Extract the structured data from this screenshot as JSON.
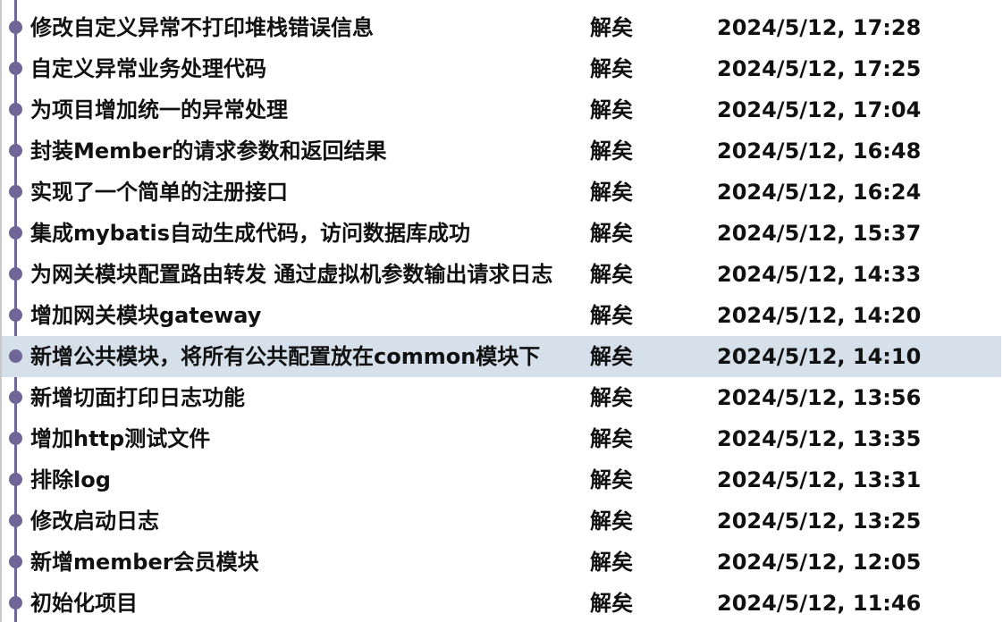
{
  "commits": [
    {
      "message": "修改自定义异常不打印堆栈错误信息",
      "author": "解矣",
      "date": "2024/5/12, 17:28"
    },
    {
      "message": "自定义异常业务处理代码",
      "author": "解矣",
      "date": "2024/5/12, 17:25"
    },
    {
      "message": "为项目增加统一的异常处理",
      "author": "解矣",
      "date": "2024/5/12, 17:04"
    },
    {
      "message": "封装Member的请求参数和返回结果",
      "author": "解矣",
      "date": "2024/5/12, 16:48"
    },
    {
      "message": "实现了一个简单的注册接口",
      "author": "解矣",
      "date": "2024/5/12, 16:24"
    },
    {
      "message": "集成mybatis自动生成代码，访问数据库成功",
      "author": "解矣",
      "date": "2024/5/12, 15:37"
    },
    {
      "message": "为网关模块配置路由转发 通过虚拟机参数输出请求日志",
      "author": "解矣",
      "date": "2024/5/12, 14:33"
    },
    {
      "message": "增加网关模块gateway",
      "author": "解矣",
      "date": "2024/5/12, 14:20"
    },
    {
      "message": "新增公共模块，将所有公共配置放在common模块下",
      "author": "解矣",
      "date": "2024/5/12, 14:10"
    },
    {
      "message": "新增切面打印日志功能",
      "author": "解矣",
      "date": "2024/5/12, 13:56"
    },
    {
      "message": "增加http测试文件",
      "author": "解矣",
      "date": "2024/5/12, 13:35"
    },
    {
      "message": "排除log",
      "author": "解矣",
      "date": "2024/5/12, 13:31"
    },
    {
      "message": "修改启动日志",
      "author": "解矣",
      "date": "2024/5/12, 13:25"
    },
    {
      "message": "新增member会员模块",
      "author": "解矣",
      "date": "2024/5/12, 12:05"
    },
    {
      "message": "初始化项目",
      "author": "解矣",
      "date": "2024/5/12, 11:46"
    }
  ],
  "selected_index": 8,
  "colors": {
    "graph": "#6f6596",
    "selected_row": "#d6e0ea",
    "text": "#111111"
  }
}
